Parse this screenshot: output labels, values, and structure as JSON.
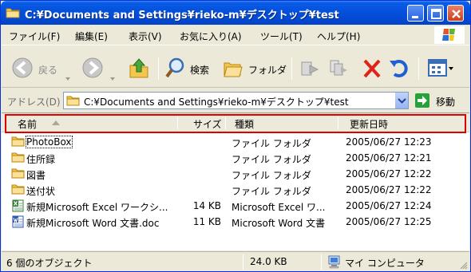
{
  "window": {
    "title": "C:¥Documents and Settings¥rieko-m¥デスクトップ¥test"
  },
  "menubar": {
    "items": [
      "ファイル(F)",
      "編集(E)",
      "表示(V)",
      "お気に入り(A)",
      "ツール(T)",
      "ヘルプ(H)"
    ]
  },
  "toolbar": {
    "back_label": "戻る",
    "search_label": "検索",
    "folders_label": "フォルダ"
  },
  "address": {
    "label": "アドレス(D)",
    "value": "C:¥Documents and Settings¥rieko-m¥デスクトップ¥test",
    "go_label": "移動"
  },
  "list": {
    "columns": [
      "名前",
      "サイズ",
      "種類",
      "更新日時"
    ],
    "rows": [
      {
        "name": "PhotoBox",
        "size": "",
        "type": "ファイル フォルダ",
        "date": "2005/06/27 12:23",
        "icon": "folder-icon"
      },
      {
        "name": "住所録",
        "size": "",
        "type": "ファイル フォルダ",
        "date": "2005/06/27 12:21",
        "icon": "folder-icon"
      },
      {
        "name": "図書",
        "size": "",
        "type": "ファイル フォルダ",
        "date": "2005/06/27 12:22",
        "icon": "folder-icon"
      },
      {
        "name": "送付状",
        "size": "",
        "type": "ファイル フォルダ",
        "date": "2005/06/27 12:22",
        "icon": "folder-icon"
      },
      {
        "name": "新規Microsoft Excel ワークシ...",
        "size": "14 KB",
        "type": "Microsoft Excel ワ...",
        "date": "2005/06/27 12:24",
        "icon": "excel-icon"
      },
      {
        "name": "新規Microsoft Word 文書.doc",
        "size": "11 KB",
        "type": "Microsoft Word 文書",
        "date": "2005/06/27 12:25",
        "icon": "word-icon"
      }
    ]
  },
  "status": {
    "count": "6 個のオブジェクト",
    "size": "24.0 KB",
    "location": "マイ コンピュータ"
  },
  "colors": {
    "titlebar": "#0452dd",
    "highlight_box": "#e00000",
    "folder": "#f2c94c"
  }
}
